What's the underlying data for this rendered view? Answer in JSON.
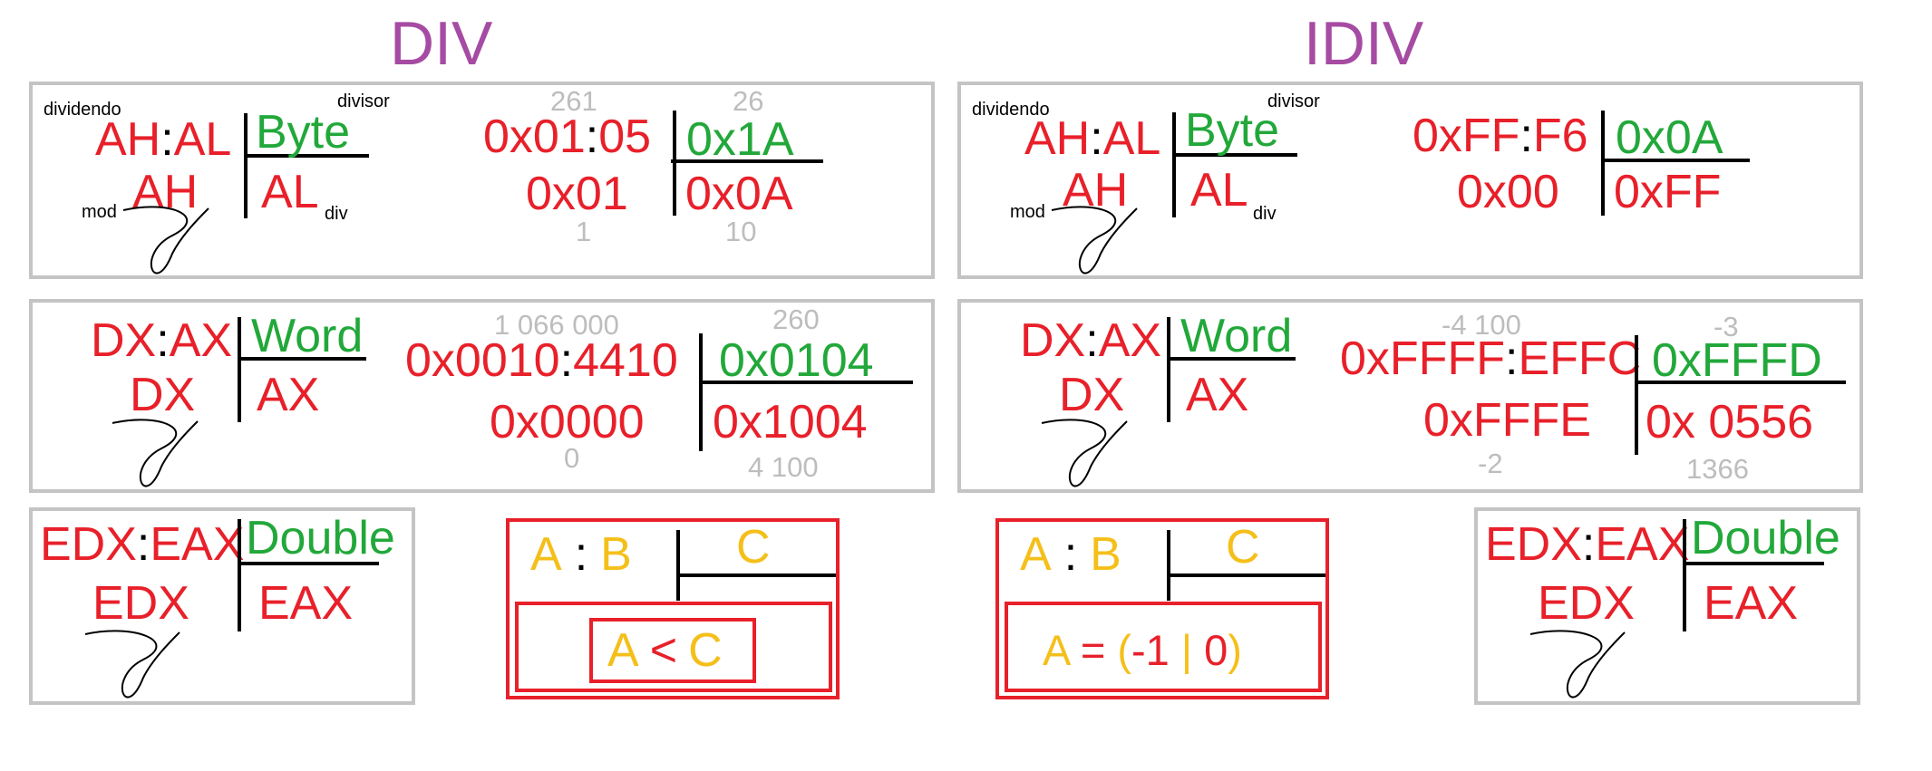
{
  "div": {
    "title": "DIV",
    "byte": {
      "dividend_label": "dividendo",
      "divisor_label": "divisor",
      "mod_label": "mod",
      "div_label": "div",
      "dividend_hi": "AH",
      "colon": ":",
      "dividend_lo": "AL",
      "divisor": "Byte",
      "remainder": "AH",
      "quotient": "AL",
      "ex": {
        "dividend_hi": "0x01",
        "colon": ":",
        "dividend_lo": "05",
        "divisor": "0x1A",
        "remainder": "0x01",
        "quotient": "0x0A",
        "dividend_dec": "261",
        "divisor_dec": "26",
        "remainder_dec": "1",
        "quotient_dec": "10"
      }
    },
    "word": {
      "dividend_hi": "DX",
      "colon": ":",
      "dividend_lo": "AX",
      "divisor": "Word",
      "remainder": "DX",
      "quotient": "AX",
      "ex": {
        "dividend_hi": "0x0010",
        "colon": ":",
        "dividend_lo": "4410",
        "divisor": "0x0104",
        "remainder": "0x0000",
        "quotient": "0x1004",
        "dividend_dec": "1 066 000",
        "divisor_dec": "260",
        "remainder_dec": "0",
        "quotient_dec": "4 100"
      }
    },
    "dword": {
      "dividend_hi": "EDX",
      "colon": ":",
      "dividend_lo": "EAX",
      "divisor": "Double",
      "remainder": "EDX",
      "quotient": "EAX"
    },
    "rule": {
      "a": "A",
      "colon": ":",
      "b": "B",
      "c": "C",
      "cond_a": "A",
      "cond_op": "<",
      "cond_c": "C"
    }
  },
  "idiv": {
    "title": "IDIV",
    "byte": {
      "dividend_label": "dividendo",
      "divisor_label": "divisor",
      "mod_label": "mod",
      "div_label": "div",
      "dividend_hi": "AH",
      "colon": ":",
      "dividend_lo": "AL",
      "divisor": "Byte",
      "remainder": "AH",
      "quotient": "AL",
      "ex": {
        "dividend_hi": "0xFF",
        "colon": ":",
        "dividend_lo": "F6",
        "divisor": "0x0A",
        "remainder": "0x00",
        "quotient": "0xFF"
      }
    },
    "word": {
      "dividend_hi": "DX",
      "colon": ":",
      "dividend_lo": "AX",
      "divisor": "Word",
      "remainder": "DX",
      "quotient": "AX",
      "ex": {
        "dividend_hi": "0xFFFF",
        "colon": ":",
        "dividend_lo": "EFFC",
        "divisor": "0xFFFD",
        "remainder": "0xFFFE",
        "quotient": "0x 0556",
        "dividend_dec": "-4 100",
        "divisor_dec": "-3",
        "remainder_dec": "-2",
        "quotient_dec": "1366"
      }
    },
    "dword": {
      "dividend_hi": "EDX",
      "colon": ":",
      "dividend_lo": "EAX",
      "divisor": "Double",
      "remainder": "EDX",
      "quotient": "EAX"
    },
    "rule": {
      "a": "A",
      "colon": ":",
      "b": "B",
      "c": "C",
      "cond_a": "A",
      "cond_eq": "=",
      "cond_open": "(",
      "cond_neg": "-1",
      "cond_bar": "|",
      "cond_zero": "0",
      "cond_close": ")"
    }
  },
  "colors": {
    "register": "#e8202a",
    "operand_size": "#22a83a",
    "decimal_note": "#bdbdbd",
    "title": "#a64ba3",
    "rule_letters": "#f5bf1a",
    "box_border": "#c4c4c4",
    "rule_border": "#e8202a"
  }
}
